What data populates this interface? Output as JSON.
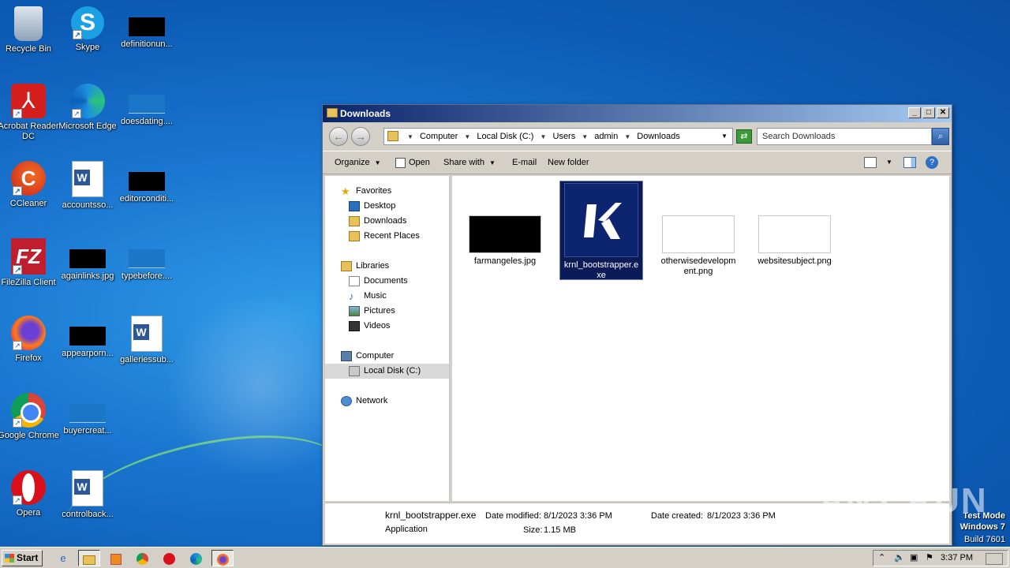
{
  "desktop": {
    "icons": [
      {
        "label": "Recycle Bin",
        "icon": "recycle-bin-icon"
      },
      {
        "label": "Skype",
        "icon": "skype-icon"
      },
      {
        "label": "definitionun...",
        "icon": "image-thumbnail-icon"
      },
      {
        "label": "Acrobat Reader DC",
        "icon": "acrobat-icon"
      },
      {
        "label": "Microsoft Edge",
        "icon": "edge-icon"
      },
      {
        "label": "doesdating....",
        "icon": "image-thumbnail-icon"
      },
      {
        "label": "CCleaner",
        "icon": "ccleaner-icon"
      },
      {
        "label": "accountsso...",
        "icon": "word-document-icon"
      },
      {
        "label": "editorconditi...",
        "icon": "image-thumbnail-icon"
      },
      {
        "label": "FileZilla Client",
        "icon": "filezilla-icon"
      },
      {
        "label": "againlinks.jpg",
        "icon": "image-thumbnail-icon"
      },
      {
        "label": "typebefore....",
        "icon": "image-thumbnail-icon"
      },
      {
        "label": "Firefox",
        "icon": "firefox-icon"
      },
      {
        "label": "appearporn...",
        "icon": "image-thumbnail-icon"
      },
      {
        "label": "galleriessub...",
        "icon": "word-document-icon"
      },
      {
        "label": "Google Chrome",
        "icon": "chrome-icon"
      },
      {
        "label": "buyercreat...",
        "icon": "image-thumbnail-icon"
      },
      {
        "label": "Opera",
        "icon": "opera-icon"
      },
      {
        "label": "controlback...",
        "icon": "word-document-icon"
      }
    ]
  },
  "window": {
    "title": "Downloads",
    "address": {
      "crumbs": [
        "Computer",
        "Local Disk (C:)",
        "Users",
        "admin",
        "Downloads"
      ]
    },
    "search": {
      "placeholder": "Search Downloads"
    },
    "toolbar": {
      "organize": "Organize",
      "open": "Open",
      "share_with": "Share with",
      "email": "E-mail",
      "new_folder": "New folder"
    },
    "nav": {
      "favorites": "Favorites",
      "desktop": "Desktop",
      "downloads": "Downloads",
      "recent_places": "Recent Places",
      "libraries": "Libraries",
      "documents": "Documents",
      "music": "Music",
      "pictures": "Pictures",
      "videos": "Videos",
      "computer": "Computer",
      "local_disk": "Local Disk (C:)",
      "network": "Network"
    },
    "files": [
      {
        "name": "farmangeles.jpg",
        "type": "image"
      },
      {
        "name": "krnl_bootstrapper.exe",
        "type": "application",
        "selected": true
      },
      {
        "name": "otherwisedevelopment.png",
        "type": "image"
      },
      {
        "name": "websitesubject.png",
        "type": "image"
      }
    ],
    "details": {
      "name": "krnl_bootstrapper.exe",
      "type": "Application",
      "modified_label": "Date modified:",
      "modified_value": "8/1/2023 3:36 PM",
      "size_label": "Size:",
      "size_value": "1.15 MB",
      "created_label": "Date created:",
      "created_value": "8/1/2023 3:36 PM"
    }
  },
  "watermark": "ANY RUN",
  "os_info": {
    "line1": "Test Mode",
    "line2": "Windows 7",
    "line3": "Build 7601"
  },
  "taskbar": {
    "start_label": "Start",
    "clock": "3:37 PM",
    "apps": [
      "internet-explorer-icon",
      "explorer-icon",
      "media-player-icon",
      "chrome-icon",
      "opera-icon",
      "edge-icon",
      "firefox-icon"
    ]
  },
  "colors": {
    "selection": "#0b1b57",
    "titlebar_start": "#0a246a",
    "titlebar_end": "#a6caf0"
  }
}
